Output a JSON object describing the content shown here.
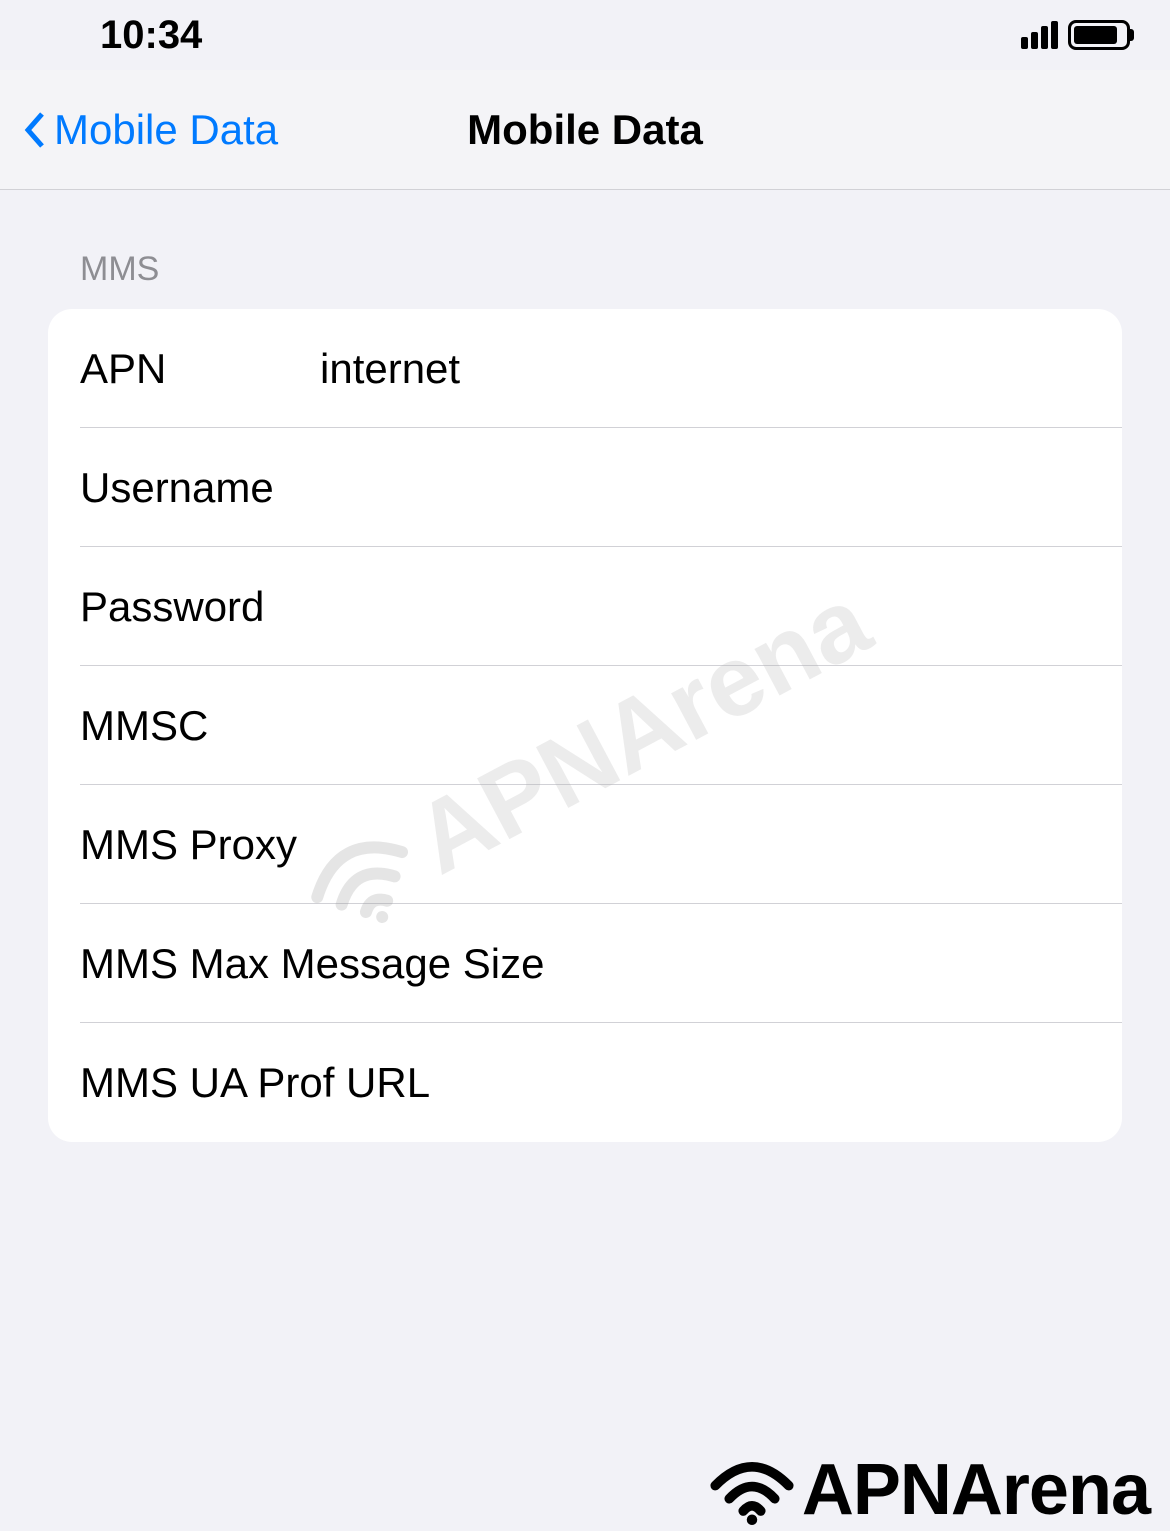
{
  "status": {
    "time": "10:34"
  },
  "nav": {
    "back_label": "Mobile Data",
    "title": "Mobile Data"
  },
  "section": {
    "header": "MMS"
  },
  "fields": {
    "apn": {
      "label": "APN",
      "value": "internet"
    },
    "username": {
      "label": "Username",
      "value": ""
    },
    "password": {
      "label": "Password",
      "value": ""
    },
    "mmsc": {
      "label": "MMSC",
      "value": ""
    },
    "mms_proxy": {
      "label": "MMS Proxy",
      "value": ""
    },
    "mms_max_size": {
      "label": "MMS Max Message Size",
      "value": ""
    },
    "mms_ua_prof": {
      "label": "MMS UA Prof URL",
      "value": ""
    }
  },
  "watermark": {
    "text": "APNArena"
  },
  "brand": {
    "text": "APNArena"
  }
}
